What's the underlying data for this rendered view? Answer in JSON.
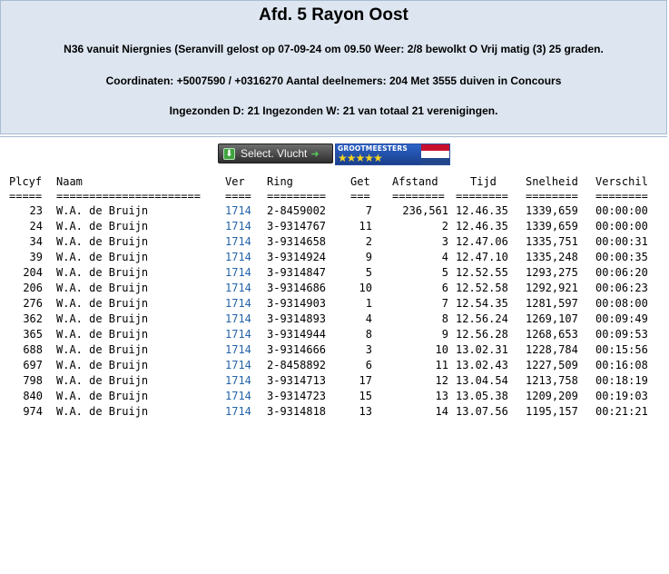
{
  "header": {
    "title": "Afd. 5 Rayon Oost",
    "line1": "N36 vanuit Niergnies (Seranvill gelost op 07-09-24 om 09.50 Weer: 2/8 bewolkt O Vrij matig (3) 25 graden.",
    "line2": "Coordinaten: +5007590 / +0316270 Aantal deelnemers: 204 Met 3555 duiven in Concours",
    "line3": "Ingezonden D: 21 Ingezonden W: 21 van totaal 21 verenigingen."
  },
  "toolbar": {
    "select_label": "Select. Vlucht",
    "badge_text": "GROOTMEESTERS",
    "badge_stars": "★★★★★"
  },
  "icons": {
    "select": "download-icon",
    "arrow": "arrow-right-icon",
    "flag": "netherlands-flag"
  },
  "colors": {
    "header_bg": "#dde6f0",
    "link": "#2463a8",
    "badge_blue": "#2c63c8",
    "star": "#f4d322"
  },
  "columns": {
    "plcyf": "Plcyf",
    "naam": "Naam",
    "ver": "Ver",
    "ring": "Ring",
    "get": "Get",
    "afstand": "Afstand",
    "tijd": "Tijd",
    "snelheid": "Snelheid",
    "verschil": "Verschil"
  },
  "separators": {
    "plcyf": "=====",
    "naam": "======================",
    "ver": "====",
    "ring": "=========",
    "get": "===",
    "afstand": "========",
    "tijd": "========",
    "snelheid": "========",
    "verschil": "========"
  },
  "rows": [
    {
      "plcyf": "23",
      "naam": "W.A. de Bruijn",
      "ver": "1714",
      "ring": "2-8459002",
      "get": "7",
      "afstand": "236,561",
      "tijd": "12.46.35",
      "snelheid": "1339,659",
      "verschil": "00:00:00"
    },
    {
      "plcyf": "24",
      "naam": "W.A. de Bruijn",
      "ver": "1714",
      "ring": "3-9314767",
      "get": "11",
      "afstand": "2",
      "tijd": "12.46.35",
      "snelheid": "1339,659",
      "verschil": "00:00:00"
    },
    {
      "plcyf": "34",
      "naam": "W.A. de Bruijn",
      "ver": "1714",
      "ring": "3-9314658",
      "get": "2",
      "afstand": "3",
      "tijd": "12.47.06",
      "snelheid": "1335,751",
      "verschil": "00:00:31"
    },
    {
      "plcyf": "39",
      "naam": "W.A. de Bruijn",
      "ver": "1714",
      "ring": "3-9314924",
      "get": "9",
      "afstand": "4",
      "tijd": "12.47.10",
      "snelheid": "1335,248",
      "verschil": "00:00:35"
    },
    {
      "plcyf": "204",
      "naam": "W.A. de Bruijn",
      "ver": "1714",
      "ring": "3-9314847",
      "get": "5",
      "afstand": "5",
      "tijd": "12.52.55",
      "snelheid": "1293,275",
      "verschil": "00:06:20"
    },
    {
      "plcyf": "206",
      "naam": "W.A. de Bruijn",
      "ver": "1714",
      "ring": "3-9314686",
      "get": "10",
      "afstand": "6",
      "tijd": "12.52.58",
      "snelheid": "1292,921",
      "verschil": "00:06:23"
    },
    {
      "plcyf": "276",
      "naam": "W.A. de Bruijn",
      "ver": "1714",
      "ring": "3-9314903",
      "get": "1",
      "afstand": "7",
      "tijd": "12.54.35",
      "snelheid": "1281,597",
      "verschil": "00:08:00"
    },
    {
      "plcyf": "362",
      "naam": "W.A. de Bruijn",
      "ver": "1714",
      "ring": "3-9314893",
      "get": "4",
      "afstand": "8",
      "tijd": "12.56.24",
      "snelheid": "1269,107",
      "verschil": "00:09:49"
    },
    {
      "plcyf": "365",
      "naam": "W.A. de Bruijn",
      "ver": "1714",
      "ring": "3-9314944",
      "get": "8",
      "afstand": "9",
      "tijd": "12.56.28",
      "snelheid": "1268,653",
      "verschil": "00:09:53"
    },
    {
      "plcyf": "688",
      "naam": "W.A. de Bruijn",
      "ver": "1714",
      "ring": "3-9314666",
      "get": "3",
      "afstand": "10",
      "tijd": "13.02.31",
      "snelheid": "1228,784",
      "verschil": "00:15:56"
    },
    {
      "plcyf": "697",
      "naam": "W.A. de Bruijn",
      "ver": "1714",
      "ring": "2-8458892",
      "get": "6",
      "afstand": "11",
      "tijd": "13.02.43",
      "snelheid": "1227,509",
      "verschil": "00:16:08"
    },
    {
      "plcyf": "798",
      "naam": "W.A. de Bruijn",
      "ver": "1714",
      "ring": "3-9314713",
      "get": "17",
      "afstand": "12",
      "tijd": "13.04.54",
      "snelheid": "1213,758",
      "verschil": "00:18:19"
    },
    {
      "plcyf": "840",
      "naam": "W.A. de Bruijn",
      "ver": "1714",
      "ring": "3-9314723",
      "get": "15",
      "afstand": "13",
      "tijd": "13.05.38",
      "snelheid": "1209,209",
      "verschil": "00:19:03"
    },
    {
      "plcyf": "974",
      "naam": "W.A. de Bruijn",
      "ver": "1714",
      "ring": "3-9314818",
      "get": "13",
      "afstand": "14",
      "tijd": "13.07.56",
      "snelheid": "1195,157",
      "verschil": "00:21:21"
    }
  ]
}
